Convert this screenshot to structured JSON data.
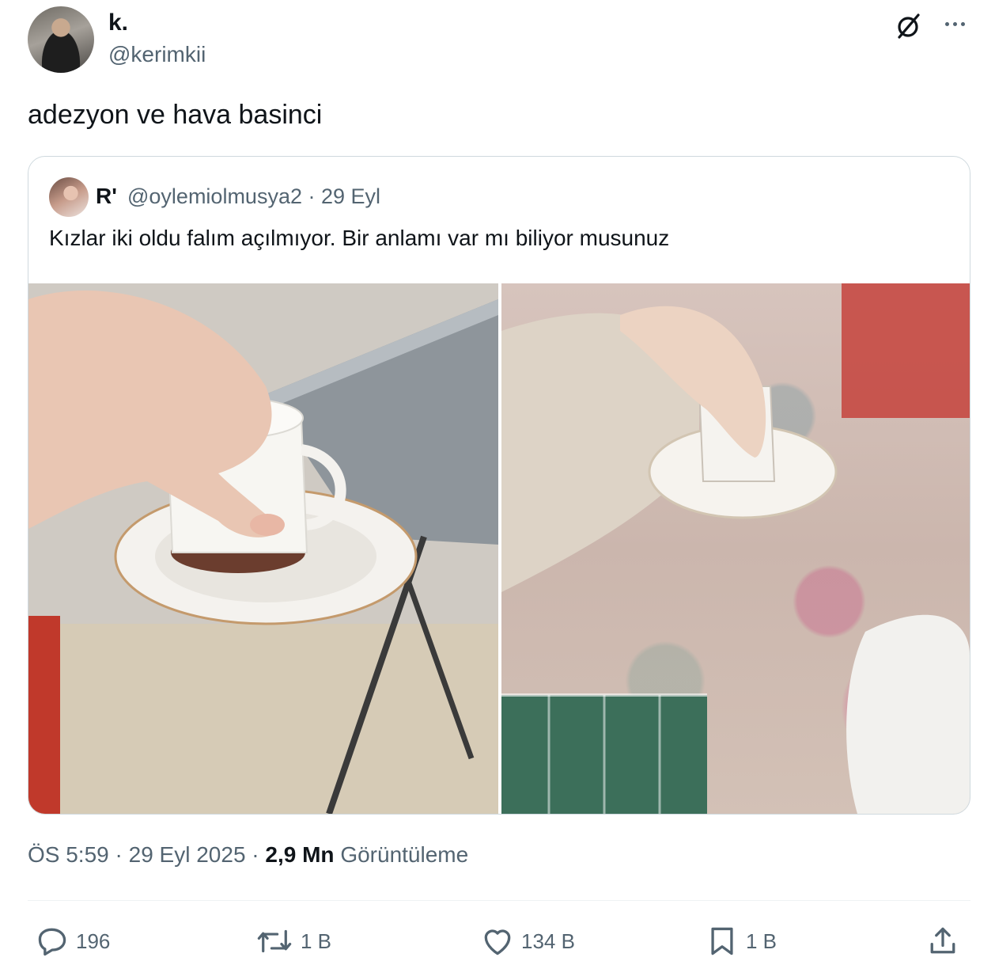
{
  "author": {
    "display_name": "k.",
    "handle": "@kerimkii"
  },
  "tweet": {
    "text": "adezyon ve hava basinci"
  },
  "quoted": {
    "display_name": "R'",
    "handle": "@oylemiolmusya2",
    "date": "29 Eyl",
    "text": "Kızlar iki oldu falım açılmıyor. Bir anlamı var mı biliyor musunuz"
  },
  "meta": {
    "time": "ÖS 5:59",
    "date": "29 Eyl 2025",
    "views": "2,9 Mn",
    "views_label": "Görüntüleme"
  },
  "actions": {
    "replies": "196",
    "reposts": "1 B",
    "likes": "134 B",
    "bookmarks": "1 B"
  },
  "icons": [
    "grok-icon",
    "more-icon",
    "reply-icon",
    "repost-icon",
    "like-icon",
    "bookmark-icon",
    "share-icon"
  ]
}
